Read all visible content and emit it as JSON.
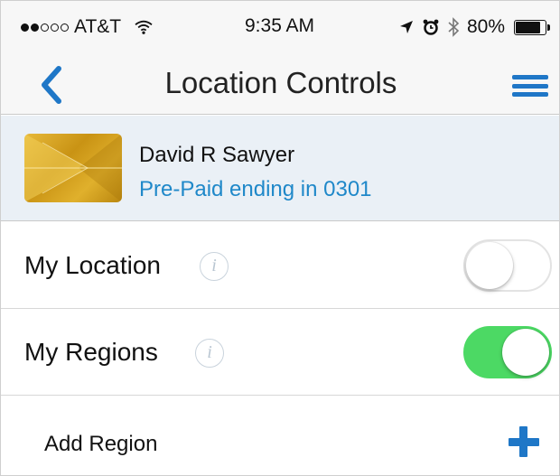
{
  "status_bar": {
    "carrier": "AT&T",
    "signal_bars_filled": 2,
    "signal_bars_total": 5,
    "time": "9:35 AM",
    "battery": "80%",
    "battery_level": 0.8,
    "icons": [
      "wifi-icon",
      "location-arrow-icon",
      "alarm-icon",
      "bluetooth-icon",
      "battery-icon"
    ]
  },
  "nav": {
    "title": "Location Controls",
    "back_icon": "chevron-left-icon",
    "menu_icon": "hamburger-menu-icon"
  },
  "account": {
    "name": "David R Sawyer",
    "card_description": "Pre-Paid ending in 0301"
  },
  "settings": [
    {
      "label": "My Location",
      "enabled": false
    },
    {
      "label": "My Regions",
      "enabled": true
    }
  ],
  "add_region": {
    "label": "Add Region",
    "icon": "plus-icon"
  },
  "colors": {
    "accent": "#1f77c7",
    "link": "#1f88c9",
    "toggle_on": "#4cd964",
    "account_bg": "#eaf0f6"
  }
}
